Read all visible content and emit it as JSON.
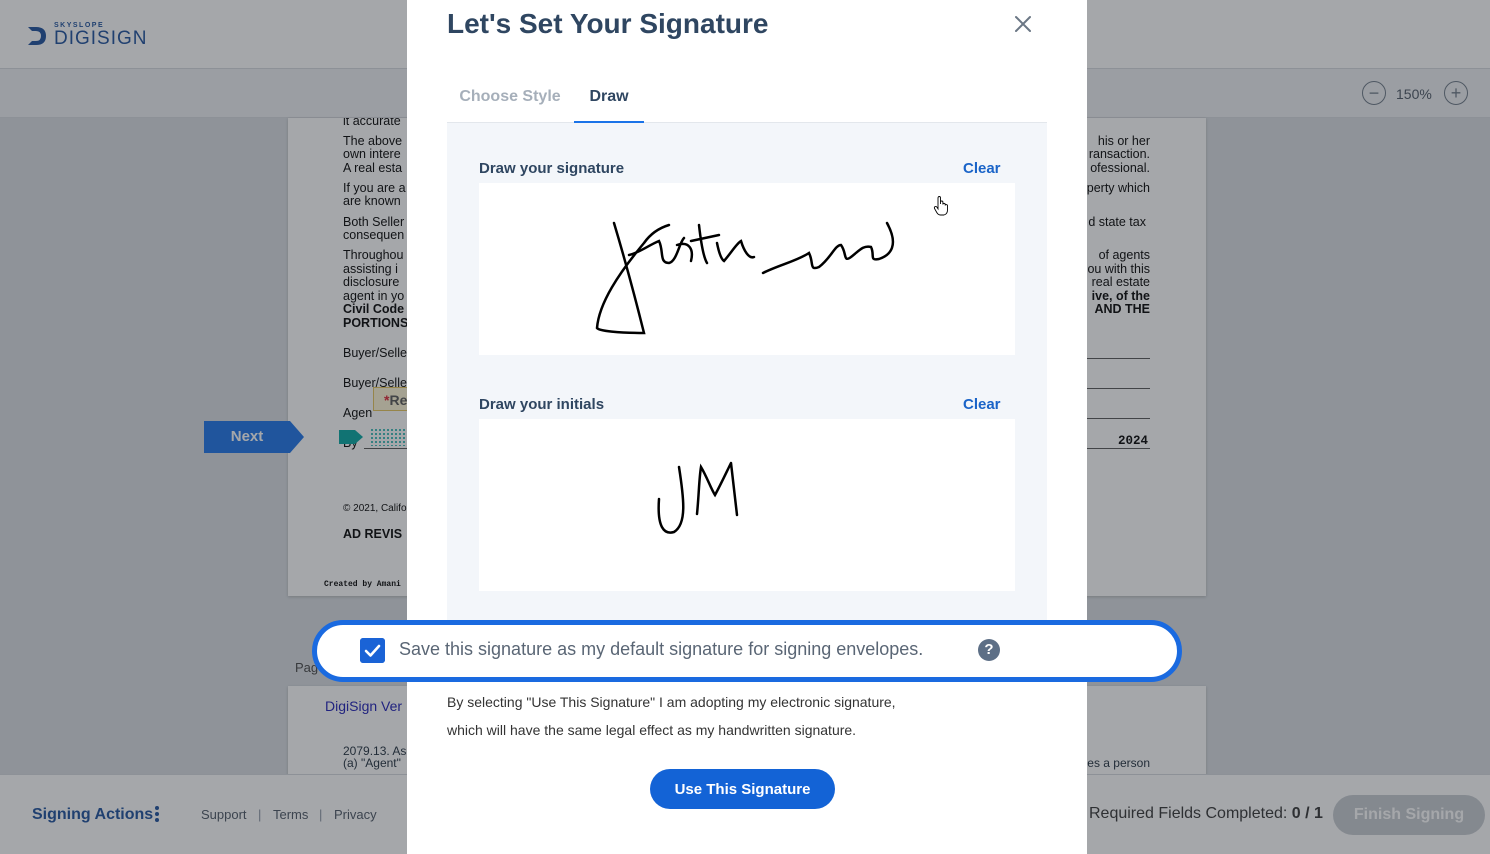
{
  "app": {
    "logo_small": "SKYSLOPE",
    "logo_big": "DIGISIGN",
    "brand_color": "#1b4f9c"
  },
  "toolbar": {
    "zoom_out": "−",
    "zoom_level": "150%",
    "zoom_in": "+"
  },
  "document": {
    "fragments_left": [
      "it accurate",
      "The above",
      "own intere",
      "A real esta",
      "If you are a",
      "are known",
      "Both Seller",
      "consequen",
      "Throughou",
      "assisting i",
      "disclosure",
      "agent in yo",
      "Civil Code",
      "PORTIONS",
      "Buyer/Selle",
      "Buyer/Selle",
      "Agen",
      "By",
      "© 2021, Califo",
      "AD REVIS",
      "Created by Amani"
    ],
    "fragments_right": [
      "his or her",
      "ransaction.",
      "ofessional.",
      "perty which",
      "d state tax",
      "of agents",
      "ou with this",
      "real estate",
      "ive, of the",
      "AND THE",
      "2024"
    ],
    "required_tag": "Re",
    "required_marker": "*",
    "next_label": "Next",
    "page_label": "Pag",
    "page2_heading": "DigiSign Ver",
    "page2_lines": [
      "2079.13. As",
      "(a) \"Agent\"",
      "es a person"
    ]
  },
  "modal": {
    "title": "Let's Set Your Signature",
    "tabs": [
      {
        "label": "Choose Style",
        "active": false
      },
      {
        "label": "Draw",
        "active": true
      }
    ],
    "signature_label": "Draw your signature",
    "signature_clear": "Clear",
    "initials_label": "Draw your initials",
    "initials_clear": "Clear",
    "default_checkbox": {
      "label": "Save this signature as my default signature for signing envelopes.",
      "checked": true
    },
    "legal_line_1": "By selecting \"Use This Signature\" I am adopting my electronic signature,",
    "legal_line_2": "which will have the same legal effect as my handwritten signature.",
    "use_button": "Use This Signature",
    "accent_color": "#1363d6"
  },
  "footer": {
    "signing_actions": "Signing Actions",
    "links": [
      "Support",
      "Terms",
      "Privacy"
    ],
    "separator": "|",
    "required_label": "Required Fields Completed:",
    "required_value": "0 / 1",
    "finish_button": "Finish Signing"
  }
}
